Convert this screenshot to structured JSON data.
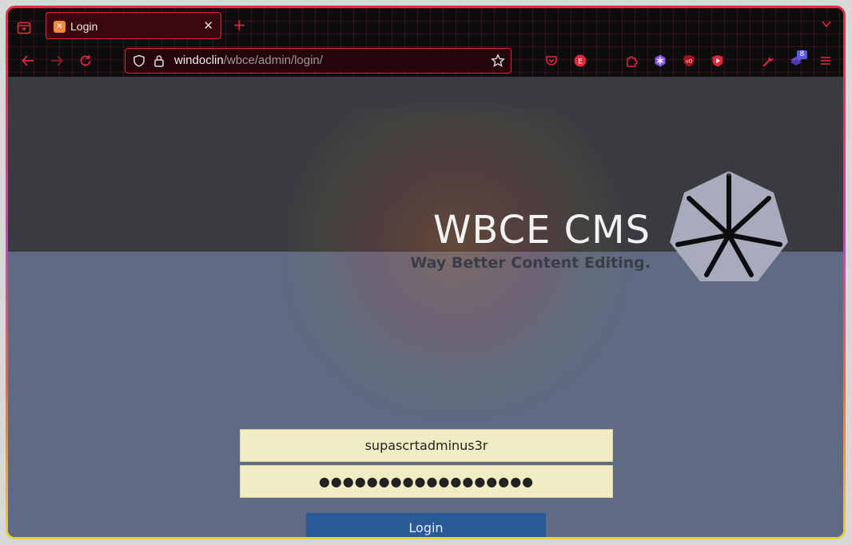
{
  "browser": {
    "tab": {
      "title": "Login",
      "close_glyph": "✕"
    },
    "new_tab_glyph": "+",
    "url": {
      "host": "windoclin",
      "path": "/wbce/admin/login/"
    },
    "extensions": [
      "pocket-icon",
      "e-extension-icon",
      "puzzle-icon",
      "snowflake-extension-icon",
      "ublock-icon",
      "youtube-extension-icon",
      "wrench-icon",
      "stack-extension-icon",
      "menu-icon"
    ],
    "extension_badge": "8",
    "accent_color": "#e0283c"
  },
  "page": {
    "site_title": "WBCE CMS",
    "site_subtitle": "Way Better Content Editing.",
    "username_value": "supascrtadminus3r",
    "password_value": "●●●●●●●●●●●●●●●●●●",
    "login_label": "Login",
    "colors": {
      "header": "#3a3b40",
      "body": "#5f6a83",
      "field": "#f1ecc4",
      "button": "#2a5a96"
    }
  }
}
